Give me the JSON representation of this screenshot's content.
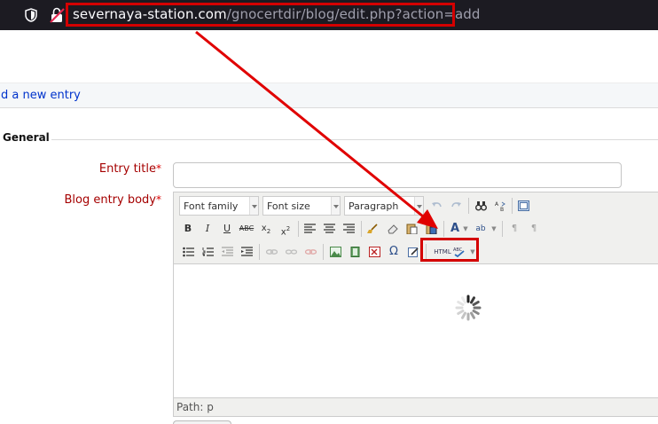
{
  "browser": {
    "url_domain": "severnaya-station.com",
    "url_path": "/gnocertdir/blog/edit.php?action=add"
  },
  "breadcrumb": {
    "link_text": "d a new entry"
  },
  "form": {
    "section_legend": "General",
    "entry_title_label": "Entry title",
    "body_label": "Blog entry body",
    "required_mark": "*",
    "entry_title_value": ""
  },
  "editor": {
    "font_family": "Font family",
    "font_size": "Font size",
    "paragraph": "Paragraph",
    "path_text": "Path: p",
    "spellcheck_text": "HTML"
  },
  "annotation": {
    "color": "#d40000"
  }
}
